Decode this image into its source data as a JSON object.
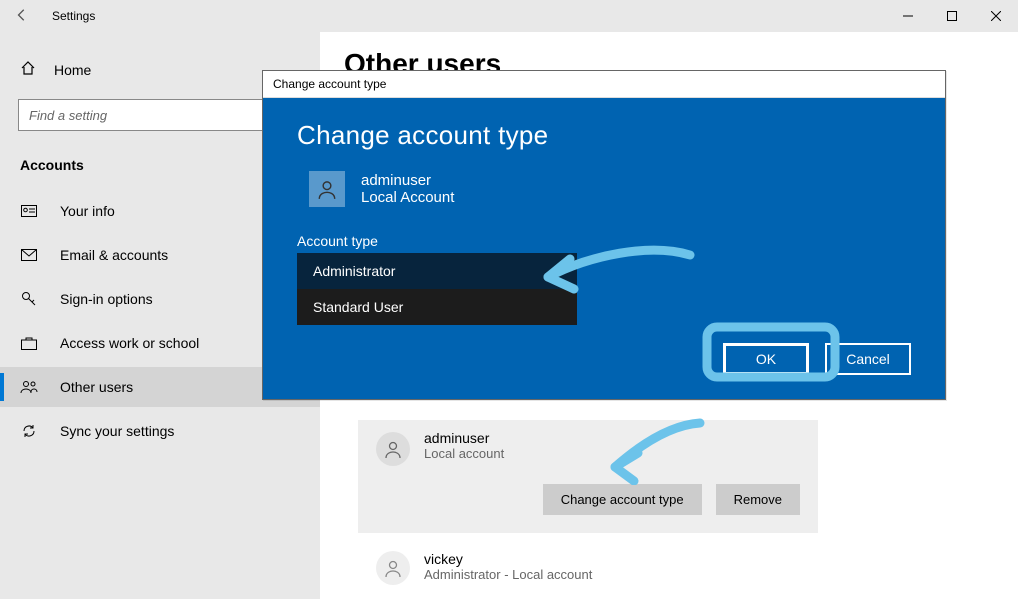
{
  "titlebar": {
    "title": "Settings"
  },
  "sidebar": {
    "home": "Home",
    "search_placeholder": "Find a setting",
    "section": "Accounts",
    "items": [
      {
        "label": "Your info"
      },
      {
        "label": "Email & accounts"
      },
      {
        "label": "Sign-in options"
      },
      {
        "label": "Access work or school"
      },
      {
        "label": "Other users"
      },
      {
        "label": "Sync your settings"
      }
    ]
  },
  "main": {
    "heading": "Other users",
    "users": [
      {
        "name": "adminuser",
        "type": "Local account",
        "change_btn": "Change account type",
        "remove_btn": "Remove"
      },
      {
        "name": "vickey",
        "type": "Administrator - Local account"
      }
    ]
  },
  "dialog": {
    "title": "Change account type",
    "heading": "Change account type",
    "user_name": "adminuser",
    "user_type": "Local Account",
    "account_type_label": "Account type",
    "options": [
      {
        "label": "Administrator",
        "selected": true
      },
      {
        "label": "Standard User",
        "selected": false
      }
    ],
    "ok": "OK",
    "cancel": "Cancel"
  }
}
